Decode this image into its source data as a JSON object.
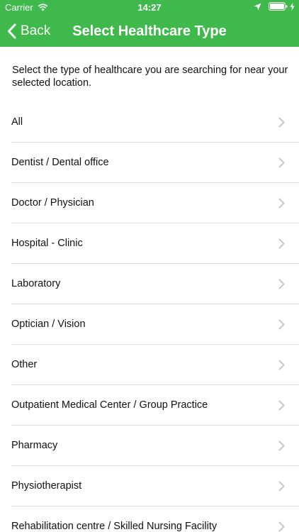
{
  "status_bar": {
    "carrier": "Carrier",
    "time": "14:27",
    "icons": [
      "wifi-icon",
      "location-arrow-icon",
      "battery-icon",
      "charging-bolt-icon"
    ]
  },
  "nav": {
    "back_label": "Back",
    "title": "Select Healthcare Type"
  },
  "intro_text": "Select the type of healthcare you are searching for near your selected location.",
  "healthcare_types": [
    "All",
    "Dentist / Dental office",
    "Doctor / Physician",
    "Hospital - Clinic",
    "Laboratory",
    "Optician / Vision",
    "Other",
    "Outpatient Medical Center / Group Practice",
    "Pharmacy",
    "Physiotherapist",
    "Rehabilitation centre / Skilled Nursing Facility"
  ],
  "colors": {
    "header_bg": "#3fb94b",
    "header_text": "#ffffff",
    "chevron": "#c7c7cc",
    "separator": "#e0e0e0"
  }
}
